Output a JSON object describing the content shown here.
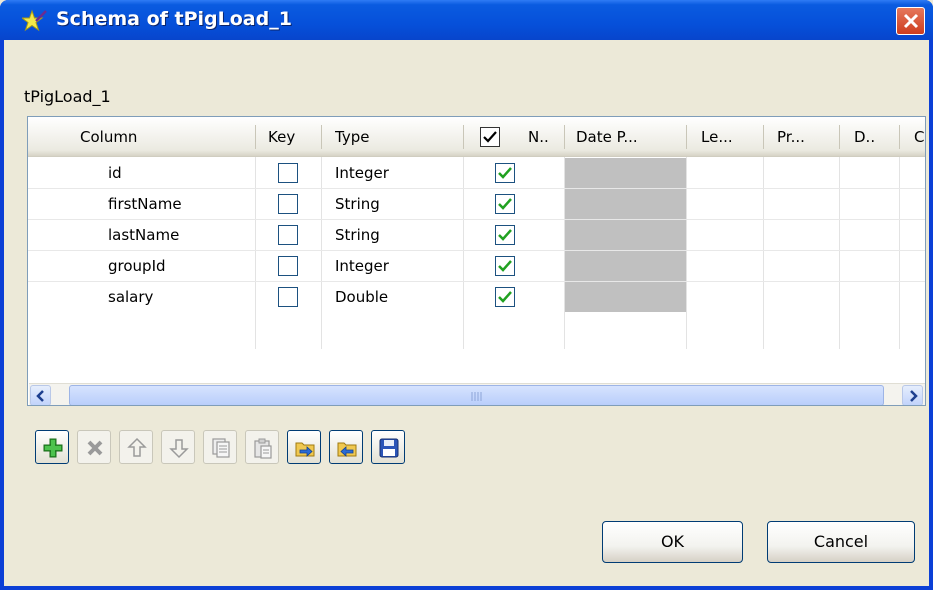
{
  "window": {
    "title": "Schema of tPigLoad_1"
  },
  "component_name": "tPigLoad_1",
  "table": {
    "headers": {
      "column": "Column",
      "key": "Key",
      "type": "Type",
      "nullable": "N..",
      "date_pattern": "Date P...",
      "length": "Le...",
      "precision": "Pr...",
      "default": "D..",
      "comment": "C"
    },
    "nullable_header_checked": true,
    "rows": [
      {
        "column": "id",
        "key": false,
        "type": "Integer",
        "nullable": true
      },
      {
        "column": "firstName",
        "key": false,
        "type": "String",
        "nullable": true
      },
      {
        "column": "lastName",
        "key": false,
        "type": "String",
        "nullable": true
      },
      {
        "column": "groupId",
        "key": false,
        "type": "Integer",
        "nullable": true
      },
      {
        "column": "salary",
        "key": false,
        "type": "Double",
        "nullable": true
      }
    ]
  },
  "toolbar": [
    {
      "name": "add-button",
      "icon": "plus-icon",
      "enabled": true
    },
    {
      "name": "remove-button",
      "icon": "delete-x-icon",
      "enabled": false
    },
    {
      "name": "move-up-button",
      "icon": "arrow-up-icon",
      "enabled": false
    },
    {
      "name": "move-down-button",
      "icon": "arrow-down-icon",
      "enabled": false
    },
    {
      "name": "copy-button",
      "icon": "copy-icon",
      "enabled": false
    },
    {
      "name": "paste-button",
      "icon": "paste-icon",
      "enabled": false
    },
    {
      "name": "import-button",
      "icon": "import-folder-icon",
      "enabled": true
    },
    {
      "name": "export-button",
      "icon": "export-folder-icon",
      "enabled": true
    },
    {
      "name": "save-button",
      "icon": "floppy-disk-icon",
      "enabled": true
    }
  ],
  "buttons": {
    "ok": "OK",
    "cancel": "Cancel"
  },
  "colors": {
    "title_bar": "#0650DA",
    "check_green": "#21A121",
    "date_cell_gray": "#C0C0C0"
  }
}
